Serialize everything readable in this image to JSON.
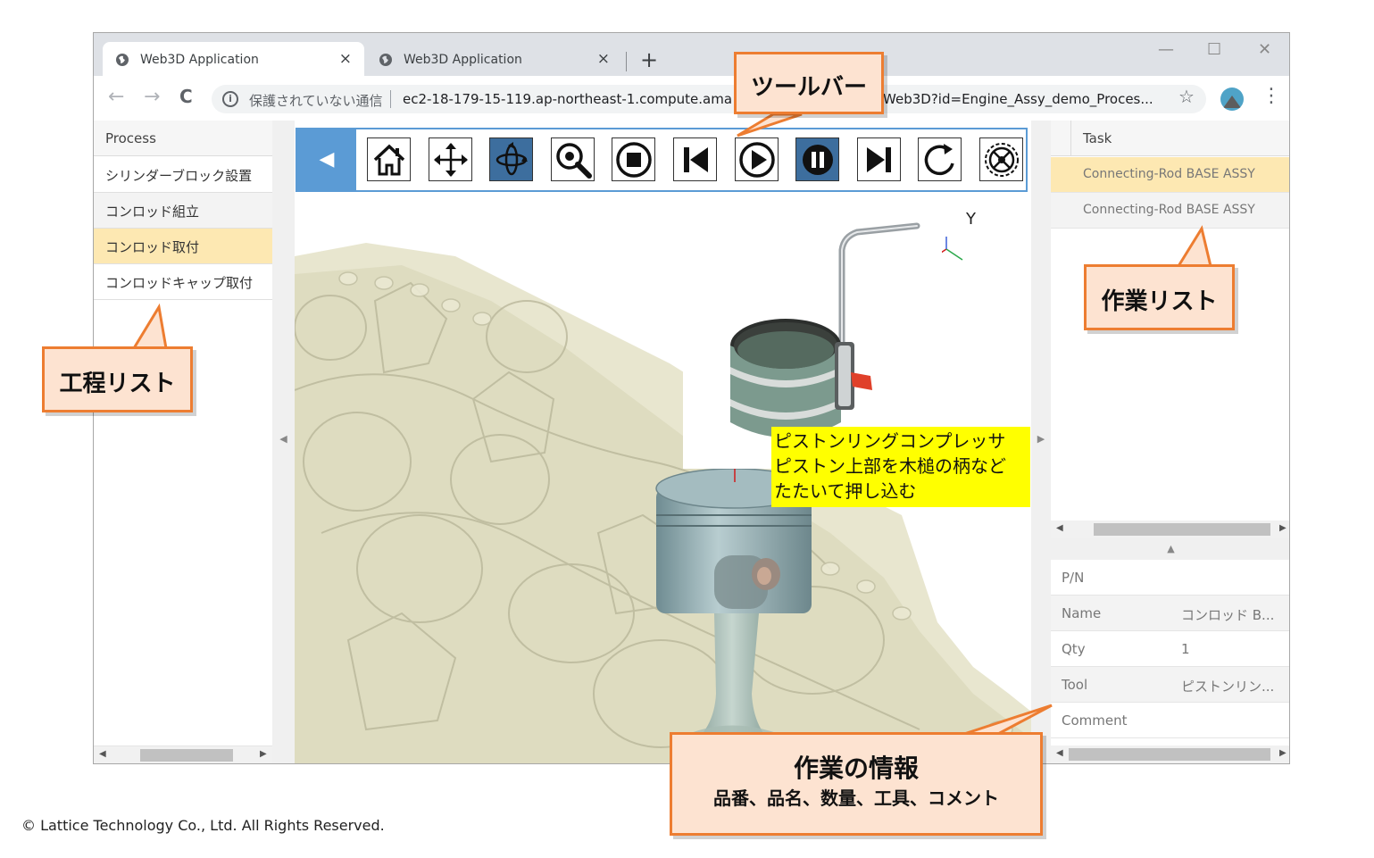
{
  "browser": {
    "tabs": [
      {
        "title": "Web3D Application"
      },
      {
        "title": "Web3D Application"
      }
    ],
    "new_tab_label": "+",
    "security_text": "保護されていない通信",
    "url_start": "ec2-18-179-15-119.ap-northeast-1.compute.ama",
    "url_end": "/Web3D?id=Engine_Assy_demo_Proces...",
    "controls": {
      "back": "←",
      "forward": "→",
      "reload": "C",
      "minimize": "—",
      "maximize": "☐",
      "close": "✕",
      "star": "☆",
      "menu": "⋮",
      "tab_close": "×",
      "info": "i"
    }
  },
  "process_panel": {
    "header": "Process",
    "items": [
      {
        "label": "シリンダーブロック設置",
        "selected": false
      },
      {
        "label": "コンロッド組立",
        "selected": false
      },
      {
        "label": "コンロッド取付",
        "selected": true
      },
      {
        "label": "コンロッドキャップ取付",
        "selected": false
      }
    ]
  },
  "viewer": {
    "toolbar_buttons": [
      {
        "name": "home",
        "active": false
      },
      {
        "name": "pan",
        "active": false
      },
      {
        "name": "rotate",
        "active": true
      },
      {
        "name": "zoom",
        "active": false
      },
      {
        "name": "stop",
        "active": false
      },
      {
        "name": "first",
        "active": false
      },
      {
        "name": "play",
        "active": false
      },
      {
        "name": "pause",
        "active": true
      },
      {
        "name": "last",
        "active": false
      },
      {
        "name": "repeat",
        "active": false
      },
      {
        "name": "settings",
        "active": false
      }
    ],
    "instruction_lines": [
      "ピストンリングコンプレッサ",
      "ピストン上部を木槌の柄など",
      "たたいて押し込む"
    ],
    "axis_label": "Y"
  },
  "task_panel": {
    "header": "Task",
    "items": [
      {
        "label": "Connecting-Rod BASE ASSY",
        "selected": true
      },
      {
        "label": "Connecting-Rod BASE ASSY",
        "selected": false
      }
    ],
    "details": [
      {
        "key": "P/N",
        "value": ""
      },
      {
        "key": "Name",
        "value": "コンロッド B..."
      },
      {
        "key": "Qty",
        "value": "1"
      },
      {
        "key": "Tool",
        "value": "ピストンリン..."
      },
      {
        "key": "Comment",
        "value": ""
      }
    ]
  },
  "callouts": {
    "toolbar": "ツールバー",
    "process_list": "工程リスト",
    "task_list": "作業リスト",
    "task_info_title": "作業の情報",
    "task_info_sub": "品番、品名、数量、工具、コメント"
  },
  "colors": {
    "accent": "#5b9bd5",
    "active_button": "#3d6e9e",
    "selected_row": "#fde8b2",
    "callout_fill": "#fde3d1",
    "callout_border": "#ed7d31",
    "instruction_bg": "#ffff00"
  },
  "footer": {
    "copyright": "© Lattice Technology Co., Ltd. All Rights Reserved."
  }
}
